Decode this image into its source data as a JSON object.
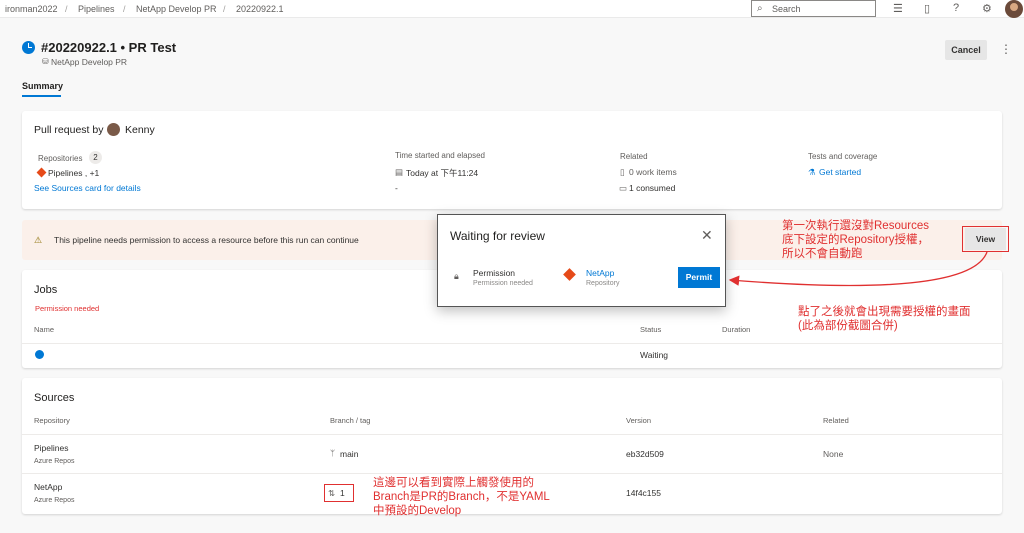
{
  "breadcrumb": [
    "ironman2022",
    "Pipelines",
    "NetApp Develop PR",
    "20220922.1"
  ],
  "search": {
    "placeholder": "Search"
  },
  "run": {
    "title": "#20220922.1 • PR Test",
    "pipeline": "NetApp Develop PR",
    "cancel_label": "Cancel"
  },
  "tabs": [
    "Summary"
  ],
  "summary": {
    "trigger_label": "Pull request by",
    "author": "Kenny",
    "repos_label": "Repositories",
    "repos_count": "2",
    "repos_value": "Pipelines , +1",
    "repos_link": "See Sources card for details",
    "time_label": "Time started and elapsed",
    "time_value": "Today at 下午11:24",
    "elapsed_value": "-",
    "related_label": "Related",
    "work_items": "0 work items",
    "consumed": "1 consumed",
    "tests_label": "Tests and coverage",
    "tests_link": "Get started"
  },
  "banner": {
    "text": "This pipeline needs permission to access a resource before this run can continue",
    "view_label": "View"
  },
  "dialog": {
    "title": "Waiting for review",
    "permission_label": "Permission",
    "permission_sub": "Permission needed",
    "repo_label": "NetApp",
    "repo_sub": "Repository",
    "permit_label": "Permit"
  },
  "jobs": {
    "title": "Jobs",
    "permission_needed": "Permission needed",
    "col_name": "Name",
    "col_status": "Status",
    "col_duration": "Duration",
    "status": "Waiting"
  },
  "sources": {
    "title": "Sources",
    "columns": [
      "Repository",
      "Branch / tag",
      "Version",
      "Related"
    ],
    "rows": [
      {
        "repo": "Pipelines",
        "type": "Azure Repos",
        "branch": "main",
        "version": "eb32d509",
        "related": "None"
      },
      {
        "repo": "NetApp",
        "type": "Azure Repos",
        "branch": "1",
        "version": "14f4c155",
        "related": ""
      }
    ]
  },
  "annotations": {
    "note1": [
      "第一次執行還沒對Resources",
      "底下設定的Repository授權，",
      "所以不會自動跑"
    ],
    "note2": [
      "點了之後就會出現需要授權的畫面",
      "(此為部份截圖合併)"
    ],
    "note3": [
      "這邊可以看到實際上觸發使用的",
      "Branch是PR的Branch，不是YAML",
      "中預設的Develop"
    ]
  },
  "colors": {
    "accent": "#0078d4",
    "annotation": "#e03030",
    "warning_bg": "#fbf0ea"
  }
}
